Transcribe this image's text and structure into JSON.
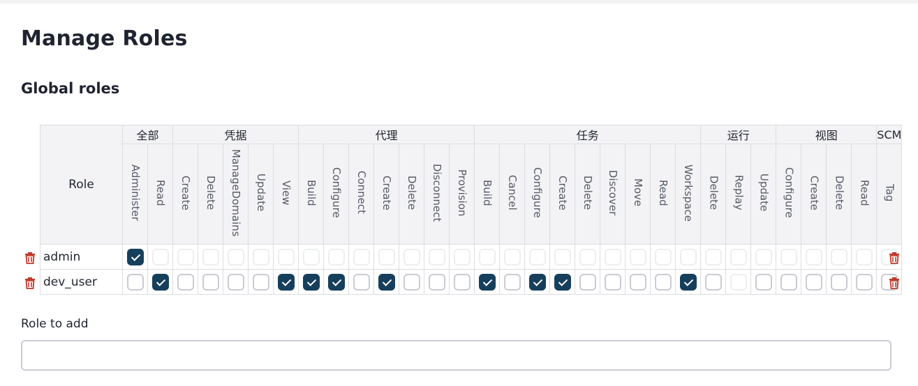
{
  "page": {
    "title": "Manage Roles",
    "section_title": "Global roles"
  },
  "table": {
    "role_header": "Role",
    "groups": [
      {
        "label": "全部",
        "permissions": [
          "Administer",
          "Read"
        ]
      },
      {
        "label": "凭据",
        "permissions": [
          "Create",
          "Delete",
          "ManageDomains",
          "Update",
          "View"
        ]
      },
      {
        "label": "代理",
        "permissions": [
          "Build",
          "Configure",
          "Connect",
          "Create",
          "Delete",
          "Disconnect",
          "Provision"
        ]
      },
      {
        "label": "任务",
        "permissions": [
          "Build",
          "Cancel",
          "Configure",
          "Create",
          "Delete",
          "Discover",
          "Move",
          "Read",
          "Workspace"
        ]
      },
      {
        "label": "运行",
        "permissions": [
          "Delete",
          "Replay",
          "Update"
        ]
      },
      {
        "label": "视图",
        "permissions": [
          "Configure",
          "Create",
          "Delete",
          "Read"
        ]
      },
      {
        "label": "SCM",
        "permissions": [
          "Tag"
        ]
      }
    ],
    "rows": [
      {
        "name": "admin",
        "checked": [
          0
        ],
        "disabled": [
          1,
          2,
          3,
          4,
          5,
          6,
          7,
          8,
          9,
          10,
          11,
          12,
          13,
          14,
          15,
          16,
          17,
          18,
          19,
          20,
          21,
          22,
          23,
          24,
          25,
          26,
          27,
          28,
          29,
          30
        ]
      },
      {
        "name": "dev_user",
        "checked": [
          1,
          6,
          7,
          8,
          10,
          14,
          16,
          17,
          22
        ],
        "disabled": [
          24
        ]
      }
    ]
  },
  "add_role": {
    "label": "Role to add",
    "value": "",
    "placeholder": ""
  },
  "icons": {
    "delete": "trash-icon",
    "check": "check-icon"
  },
  "colors": {
    "checked": "#163f5c",
    "delete": "#c0392b"
  }
}
